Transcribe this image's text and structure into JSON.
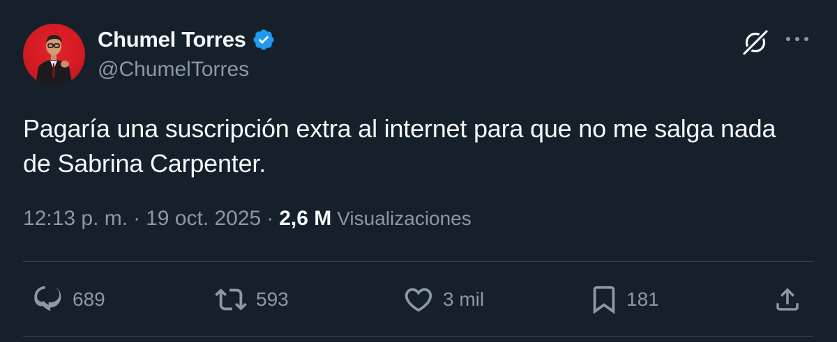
{
  "author": {
    "display_name": "Chumel Torres",
    "handle": "@ChumelTorres",
    "verified": true
  },
  "tweet": {
    "text": "Pagaría una suscripción extra al internet para que no me salga nada de Sabrina Carpenter.",
    "time": "12:13 p. m.",
    "separator": "·",
    "date": "19 oct. 2025",
    "views_count": "2,6 M",
    "views_label": "Visualizaciones"
  },
  "actions": {
    "replies": "689",
    "retweets": "593",
    "likes": "3 mil",
    "bookmarks": "181"
  },
  "icons": {
    "header": [
      "grok-icon",
      "more-icon"
    ],
    "actions": [
      "reply-icon",
      "retweet-icon",
      "like-icon",
      "bookmark-icon",
      "share-icon"
    ]
  },
  "colors": {
    "background": "#15202b",
    "text": "#f7f9f9",
    "secondary": "#8b98a5",
    "verified": "#1d9bf0",
    "divider": "#38444d"
  }
}
